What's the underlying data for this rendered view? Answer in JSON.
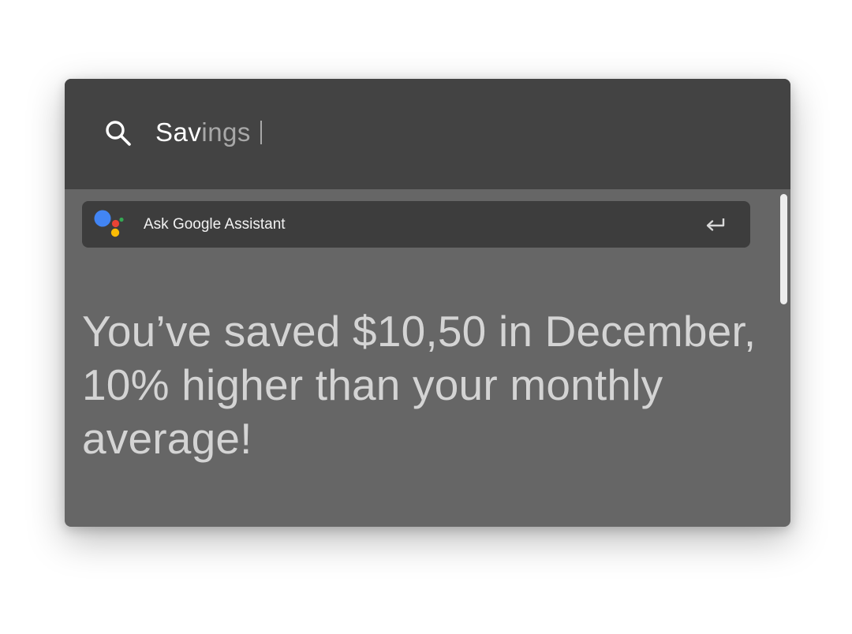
{
  "search": {
    "typed": "Sav",
    "suggestion": "ings",
    "icon": "search-icon"
  },
  "assistant": {
    "label": "Ask Google Assistant",
    "logo_icon": "google-assistant-icon",
    "action_icon": "enter-return-icon",
    "logo_colors": {
      "blue": "#4285F4",
      "red": "#EA4335",
      "yellow": "#FBBC05",
      "green": "#34A853"
    }
  },
  "result": {
    "message": "You’ve saved $10,50 in December, 10% higher than your monthly average!"
  }
}
